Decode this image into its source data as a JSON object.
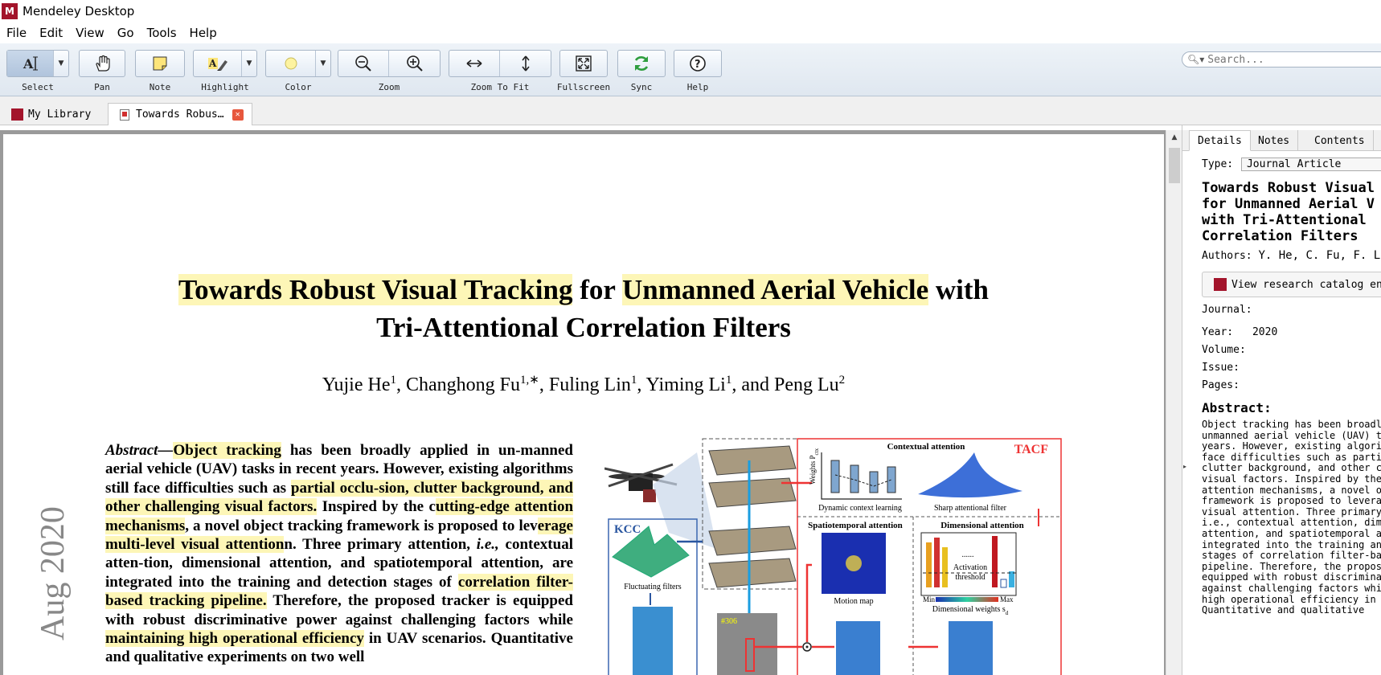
{
  "window": {
    "title": "Mendeley Desktop",
    "logo_glyph": "M"
  },
  "menu": [
    "File",
    "Edit",
    "View",
    "Go",
    "Tools",
    "Help"
  ],
  "toolbar": {
    "select": "Select",
    "pan": "Pan",
    "note": "Note",
    "highlight": "Highlight",
    "color": "Color",
    "zoom": "Zoom",
    "zoom_to_fit": "Zoom To Fit",
    "fullscreen": "Fullscreen",
    "sync": "Sync",
    "help": "Help",
    "highlight_color": "#fdf6b7",
    "sync_color": "#2f9e3e"
  },
  "search": {
    "placeholder": "Search..."
  },
  "tabs": [
    {
      "label": "My Library"
    },
    {
      "label": "Towards Robus…"
    }
  ],
  "paper": {
    "title_parts": [
      "Towards Robust Visual Tracking",
      " for ",
      "Unmanned Aerial Vehicle",
      " with"
    ],
    "title_line2": "Tri-Attentional Correlation Filters",
    "authors": [
      {
        "name": "Yujie He",
        "sup": "1"
      },
      {
        "name": "Changhong Fu",
        "sup": "1,∗"
      },
      {
        "name": "Fuling Lin",
        "sup": "1"
      },
      {
        "name": "Yiming Li",
        "sup": "1"
      },
      {
        "name": "Peng Lu",
        "sup": "2"
      }
    ],
    "author_and": "and",
    "abstract_lead": "Abstract—",
    "abstract_segments": [
      {
        "t": "Object tracking",
        "h": true
      },
      {
        "t": " has been broadly applied in un-manned aerial vehicle (UAV) tasks in recent years. However, existing algorithms still face difficulties such as ",
        "h": false
      },
      {
        "t": "partial occlu-sion, clutter background, and other challenging visual factors.",
        "h": true
      },
      {
        "t": " Inspired by the c",
        "h": false
      },
      {
        "t": "utting-edge attention mechanisms",
        "h": true
      },
      {
        "t": ", a novel object tracking framework is proposed to lev",
        "h": false
      },
      {
        "t": "erage multi-level visual attention",
        "h": true
      },
      {
        "t": "n. Three primary attention, ",
        "h": false
      },
      {
        "t": "i.e.,",
        "h": false,
        "i": true
      },
      {
        "t": " contextual atten-tion, dimensional attention, and spatiotemporal attention, are integrated into the training and detection stages of ",
        "h": false
      },
      {
        "t": "correlation filter-based tracking pipeline.",
        "h": true
      },
      {
        "t": " Therefore, the proposed tracker is equipped with robust discriminative power against challenging factors while ",
        "h": false
      },
      {
        "t": "maintaining high operational efficiency",
        "h": true
      },
      {
        "t": " in UAV scenarios. Quantitative and qualitative experiments on two well",
        "h": false
      }
    ],
    "side_stamp": "Aug 2020",
    "figure": {
      "contextual": "Contextual attention",
      "tacf": "TACF",
      "kcc": "KCC",
      "dynamic": "Dynamic context learning",
      "sharp": "Sharp attentional filter",
      "spatiotemporal": "Spatiotemporal attention",
      "dimensional": "Dimensional attention",
      "motion": "Motion map",
      "fluctuating": "Fluctuating filters",
      "activation": "Activation",
      "threshold": "threshold",
      "min": "Min",
      "max": "Max",
      "dimw": "Dimensional weights s",
      "dimw_sub": "d",
      "weights": "Weights P",
      "weights_sub": "ctx",
      "frame": "#306",
      "dots": "......"
    }
  },
  "details": {
    "tabs": [
      "Details",
      "Notes",
      "Contents"
    ],
    "type_label": "Type:",
    "type_value": "Journal Article",
    "title": "Towards Robust Visual\nfor Unmanned Aerial V\nwith Tri-Attentional\nCorrelation Filters",
    "authors_label": "Authors:",
    "authors_value": "Y. He, C. Fu, F. Lin",
    "view_catalog": "View research catalog entry",
    "journal_label": "Journal:",
    "year_label": "Year:",
    "year_value": "2020",
    "volume_label": "Volume:",
    "issue_label": "Issue:",
    "pages_label": "Pages:",
    "abstract_label": "Abstract:",
    "abstract_text": "Object tracking has been broadly\nunmanned aerial vehicle (UAV) t\nyears. However, existing algori\nface difficulties such as parti\nclutter background, and other c\nvisual factors. Inspired by the\nattention mechanisms, a novel o\nframework is proposed to levera\nvisual attention. Three primary\ni.e., contextual attention, dim\nattention, and spatiotemporal a\nintegrated into the training an\nstages of correlation filter-ba\npipeline. Therefore, the propos\nequipped with robust discrimina\nagainst challenging factors whi\nhigh operational efficiency in\nQuantitative and qualitative"
  }
}
